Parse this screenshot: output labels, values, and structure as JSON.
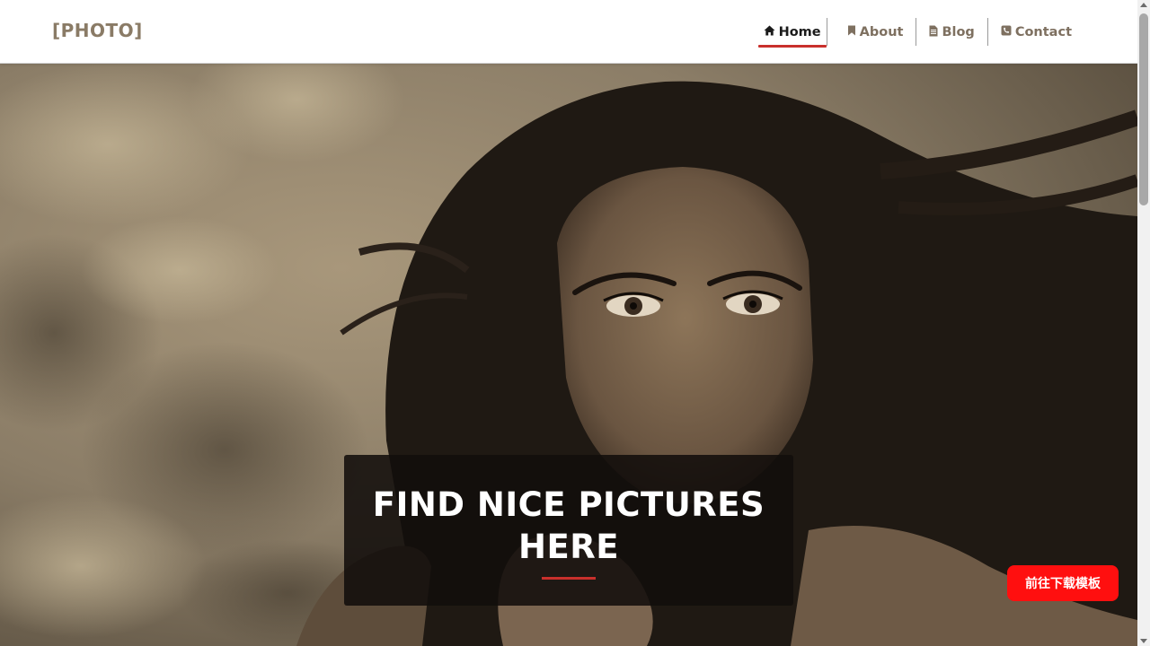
{
  "brand": {
    "logo_text": "[PHOTO]"
  },
  "nav": {
    "items": [
      {
        "label": "Home",
        "icon": "home-icon",
        "active": true
      },
      {
        "label": "About",
        "icon": "bookmark-icon",
        "active": false
      },
      {
        "label": "Blog",
        "icon": "document-icon",
        "active": false
      },
      {
        "label": "Contact",
        "icon": "phone-icon",
        "active": false
      }
    ]
  },
  "hero": {
    "image": "sepia-portrait-woman-flowing-hair",
    "caption_title": "FIND NICE PICTURES HERE"
  },
  "floating_button": {
    "label": "前往下载模板"
  },
  "colors": {
    "accent_red": "#c9302c",
    "brand_text": "#8a7b66",
    "download_button": "#ff0f0f",
    "caption_bg": "#120e0b"
  }
}
